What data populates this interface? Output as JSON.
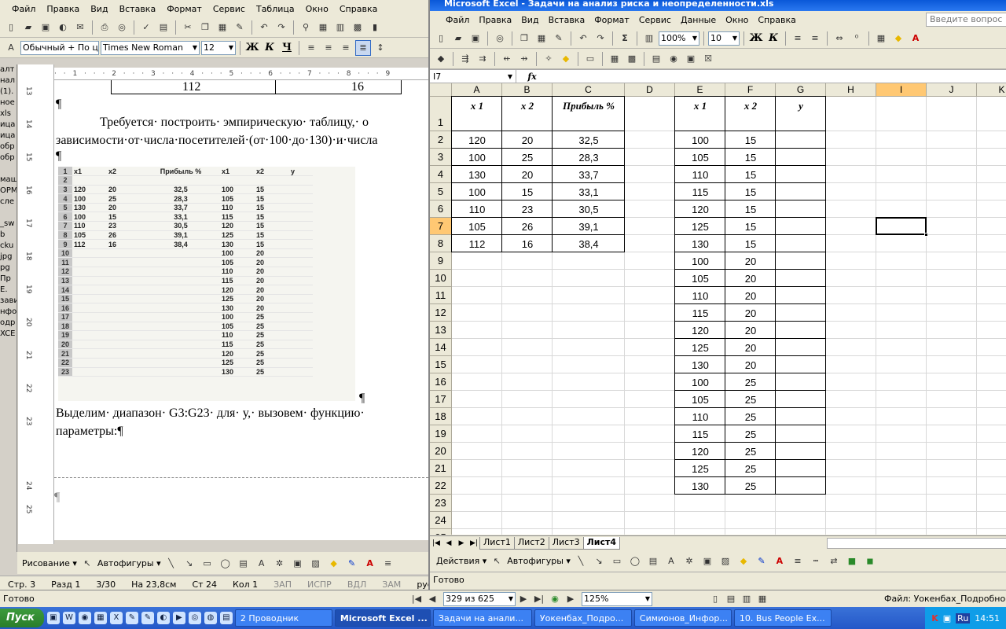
{
  "word": {
    "menu": [
      "Файл",
      "Правка",
      "Вид",
      "Вставка",
      "Формат",
      "Сервис",
      "Таблица",
      "Окно",
      "Справка"
    ],
    "style_combo": "Обычный + По ц",
    "font_combo": "Times New Roman",
    "size_combo": "12",
    "panel_items": [
      "алт",
      "нал",
      "(1).",
      "ное",
      "xls",
      "ица",
      "ица",
      "обр",
      "обр",
      "",
      "маш",
      "ОРМ",
      "сле",
      "",
      "_sw",
      "b",
      "cku",
      "jpg",
      "pg",
      "Пр",
      "Е.",
      "зави",
      "нфо",
      "одр",
      "XCE"
    ],
    "ruler_marks": [
      "13",
      "14",
      "15",
      "16",
      "17",
      "18",
      "19",
      "20",
      "21",
      "22",
      "23",
      "24",
      "25"
    ],
    "top_cells": [
      "112",
      "16"
    ],
    "para1": "Требуется· построить· эмпирическую· таблицу,· о",
    "para2": "зависимости·от·числа·посетителей·(от·100·до·130)·и·числа",
    "pilcrow": "¶",
    "para3": "Выделим· диапазон· G3:G23· для· у,· вызовем· функцию·",
    "para4": "параметры:¶",
    "scan_header": [
      "x1",
      "x2",
      "Прибыль %",
      "x1",
      "x2",
      "y"
    ],
    "status": [
      "Стр. 3",
      "Разд 1",
      "3/30",
      "На 23,8см",
      "Ст 24",
      "Кол 1",
      "ЗАП",
      "ИСПР",
      "ВДЛ",
      "ЗАМ",
      "рус"
    ],
    "draw_label": "Рисование ▾",
    "autoshapes": "Автофигуры ▾"
  },
  "excel": {
    "title": "Microsoft Excel - Задачи на анализ риска и неопределенности.xls",
    "menu": [
      "Файл",
      "Правка",
      "Вид",
      "Вставка",
      "Формат",
      "Сервис",
      "Данные",
      "Окно",
      "Справка"
    ],
    "ask_placeholder": "Введите вопрос",
    "zoom": "100%",
    "font_size": "10",
    "name_box": "I7",
    "fx": "fx",
    "columns": [
      "A",
      "B",
      "C",
      "D",
      "E",
      "F",
      "G",
      "H",
      "I",
      "J",
      "K"
    ],
    "rows": [
      "1",
      "2",
      "3",
      "4",
      "5",
      "6",
      "7",
      "8",
      "9",
      "10",
      "11",
      "12",
      "13",
      "14",
      "15",
      "16",
      "17",
      "18",
      "19",
      "20",
      "21",
      "22",
      "23",
      "24",
      "25"
    ],
    "headers": {
      "a": "x 1",
      "b": "x 2",
      "c": "Прибыль %",
      "e": "x 1",
      "f": "x 2",
      "g": "y"
    },
    "table1": [
      [
        "120",
        "20",
        "32,5"
      ],
      [
        "100",
        "25",
        "28,3"
      ],
      [
        "130",
        "20",
        "33,7"
      ],
      [
        "100",
        "15",
        "33,1"
      ],
      [
        "110",
        "23",
        "30,5"
      ],
      [
        "105",
        "26",
        "39,1"
      ],
      [
        "112",
        "16",
        "38,4"
      ]
    ],
    "table2": [
      [
        "100",
        "15"
      ],
      [
        "105",
        "15"
      ],
      [
        "110",
        "15"
      ],
      [
        "115",
        "15"
      ],
      [
        "120",
        "15"
      ],
      [
        "125",
        "15"
      ],
      [
        "130",
        "15"
      ],
      [
        "100",
        "20"
      ],
      [
        "105",
        "20"
      ],
      [
        "110",
        "20"
      ],
      [
        "115",
        "20"
      ],
      [
        "120",
        "20"
      ],
      [
        "125",
        "20"
      ],
      [
        "130",
        "20"
      ],
      [
        "100",
        "25"
      ],
      [
        "105",
        "25"
      ],
      [
        "110",
        "25"
      ],
      [
        "115",
        "25"
      ],
      [
        "120",
        "25"
      ],
      [
        "125",
        "25"
      ],
      [
        "130",
        "25"
      ]
    ],
    "sheets": [
      "Лист1",
      "Лист2",
      "Лист3",
      "Лист4"
    ],
    "active_sheet": "Лист4",
    "draw_label": "Действия ▾",
    "autoshapes": "Автофигуры ▾",
    "status": "Готово"
  },
  "bottom": {
    "left": "Готово",
    "page_counter": "329 из 625",
    "zoom": "125%",
    "file": "Файл: Уокенбах_Подробное р"
  },
  "taskbar": {
    "start": "Пуск",
    "buttons": [
      "2 Проводник",
      "Microsoft Excel ...",
      "Задачи на анали...",
      "Уокенбах_Подро...",
      "Симионов_Инфор...",
      "10. Bus People Ex..."
    ],
    "lang": "Ru",
    "clock": "14:51"
  }
}
